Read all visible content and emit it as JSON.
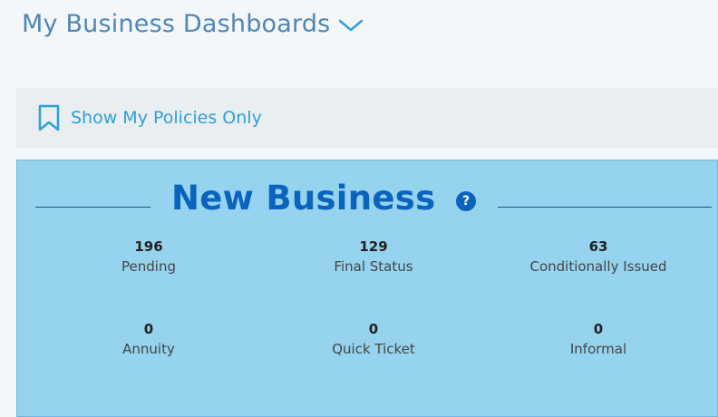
{
  "header": {
    "title": "My Business Dashboards"
  },
  "filter": {
    "label": "Show My Policies Only"
  },
  "card": {
    "title": "New Business",
    "help_icon": "?",
    "stats": [
      {
        "value": "196",
        "label": "Pending"
      },
      {
        "value": "129",
        "label": "Final Status"
      },
      {
        "value": "63",
        "label": "Conditionally Issued"
      },
      {
        "value": "0",
        "label": "Annuity"
      },
      {
        "value": "0",
        "label": "Quick Ticket"
      },
      {
        "value": "0",
        "label": "Informal"
      }
    ]
  },
  "colors": {
    "header_text": "#4f86b3",
    "link": "#2f9fd6",
    "card_bg": "#96d3ef",
    "card_title": "#0a63bd"
  },
  "icons": {
    "dashboard_menu": "chevron-down-icon",
    "filter": "bookmark-icon",
    "help": "help-circle-icon"
  }
}
